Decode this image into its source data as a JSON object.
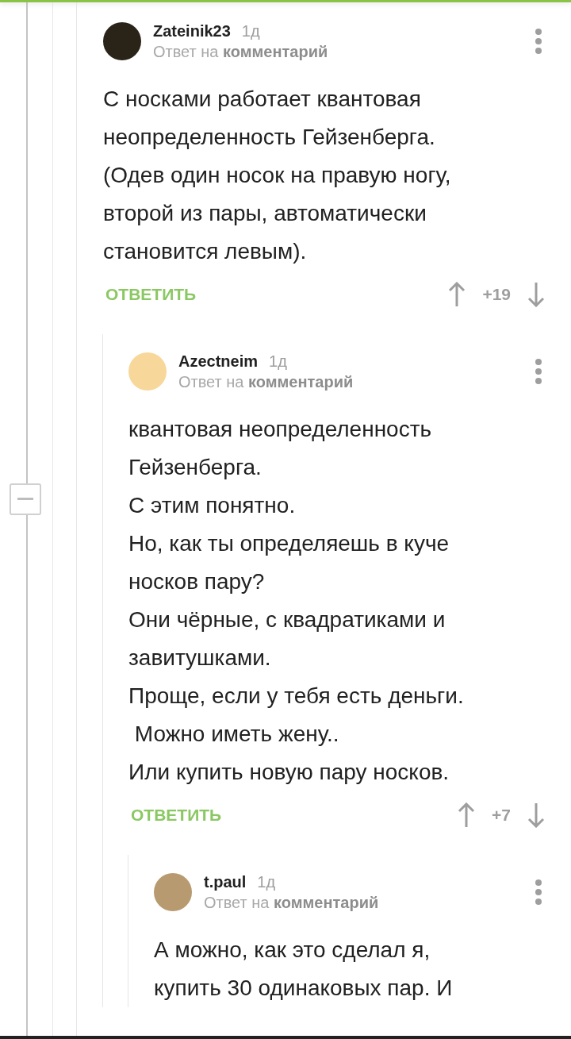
{
  "comments": [
    {
      "author": "Zateinik23",
      "time": "1д",
      "reply_to": "Ответ на **комментарий**",
      "lines": [
        "С носками работает квантовая",
        "неопределенность Гейзенберга.",
        "(Одев один носок на правую ногу,",
        "второй из пары, автоматически",
        "становится левым)."
      ],
      "reply_label": "ОТВЕТИТЬ",
      "score": "+19",
      "children": [
        {
          "author": "Azectneim",
          "time": "1д",
          "reply_to": "Ответ на **комментарий**",
          "lines": [
            "квантовая неопределенность",
            "Гейзенберга.",
            "С этим понятно.",
            "Но, как ты определяешь в куче",
            "носков пару?",
            "Они чёрные, с квадратиками и",
            "завитушками.",
            "Проще, если у тебя есть деньги.",
            " Можно иметь жену..",
            "Или купить новую пару носков."
          ],
          "reply_label": "ОТВЕТИТЬ",
          "score": "+7",
          "children": [
            {
              "author": "t.paul",
              "time": "1д",
              "reply_to": "Ответ на **комментарий**",
              "lines": [
                "А можно, как это сделал я,",
                "купить 30 одинаковых пар. И"
              ]
            }
          ]
        }
      ]
    }
  ]
}
